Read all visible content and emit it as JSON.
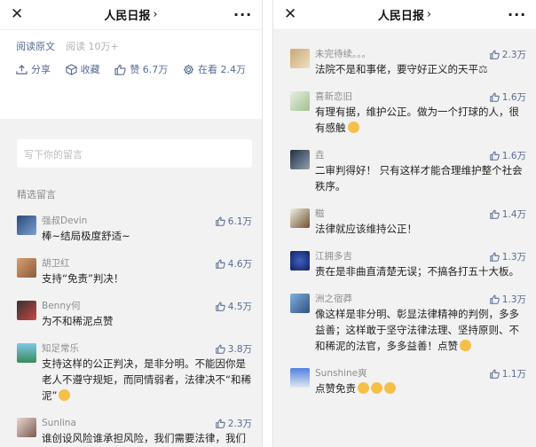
{
  "left": {
    "topbar": {
      "title": "人民日报"
    },
    "article": {
      "read_original": "阅读原文",
      "read_count": "阅读 10万+",
      "share": "分享",
      "favorite": "收藏",
      "like": "赞 6.7万",
      "wow": "在看 2.4万"
    },
    "comment_placeholder": "写下你的留言",
    "section_title": "精选留言",
    "comments": [
      {
        "name": "强叔Devin",
        "text": "棒~结局极度舒适~",
        "likes": "6.1万"
      },
      {
        "name": "胡卫红",
        "text": "支持“免责”判决！",
        "likes": "4.6万"
      },
      {
        "name": "Benny何",
        "text": "为不和稀泥点赞",
        "likes": "4.5万"
      },
      {
        "name": "知足常乐",
        "text": "支持这样的公正判决，是非分明。不能因你是老人不遵守规矩，而同情弱者，法律决不“和稀泥”",
        "likes": "3.8万"
      },
      {
        "name": "Sunlina",
        "text": "谁创设风险谁承担风险，我们需要法律，我们更相信法律",
        "likes": "2.3万"
      }
    ]
  },
  "right": {
    "topbar": {
      "title": "人民日报"
    },
    "comments": [
      {
        "name": "未完待续。。。",
        "text": "法院不是和事佬，要守好正义的天平",
        "likes": "2.3万"
      },
      {
        "name": "喜新恋旧",
        "text": "有理有据，维护公正。做为一个打球的人，很有感触",
        "likes": "1.6万"
      },
      {
        "name": "垚",
        "text": "二审判得好！ 只有这样才能合理维护整个社会秩序。",
        "likes": "1.6万"
      },
      {
        "name": "糍",
        "text": "法律就应该维持公正！",
        "likes": "1.4万"
      },
      {
        "name": "江拥多吉",
        "text": "责在是非曲直清楚无误；不搞各打五十大板。",
        "likes": "1.3万"
      },
      {
        "name": "洲之宿莽",
        "text": "像这样是非分明、彰显法律精神的判例，多多益善；这样敢于坚守法律法理、坚持原则、不和稀泥的法官，多多益善！点赞",
        "likes": "1.3万"
      },
      {
        "name": "Sunshine爽",
        "text": "点赞免责",
        "likes": "1.1万"
      }
    ]
  },
  "colors": {
    "link": "#576b95",
    "background": "#f2f2f2"
  }
}
